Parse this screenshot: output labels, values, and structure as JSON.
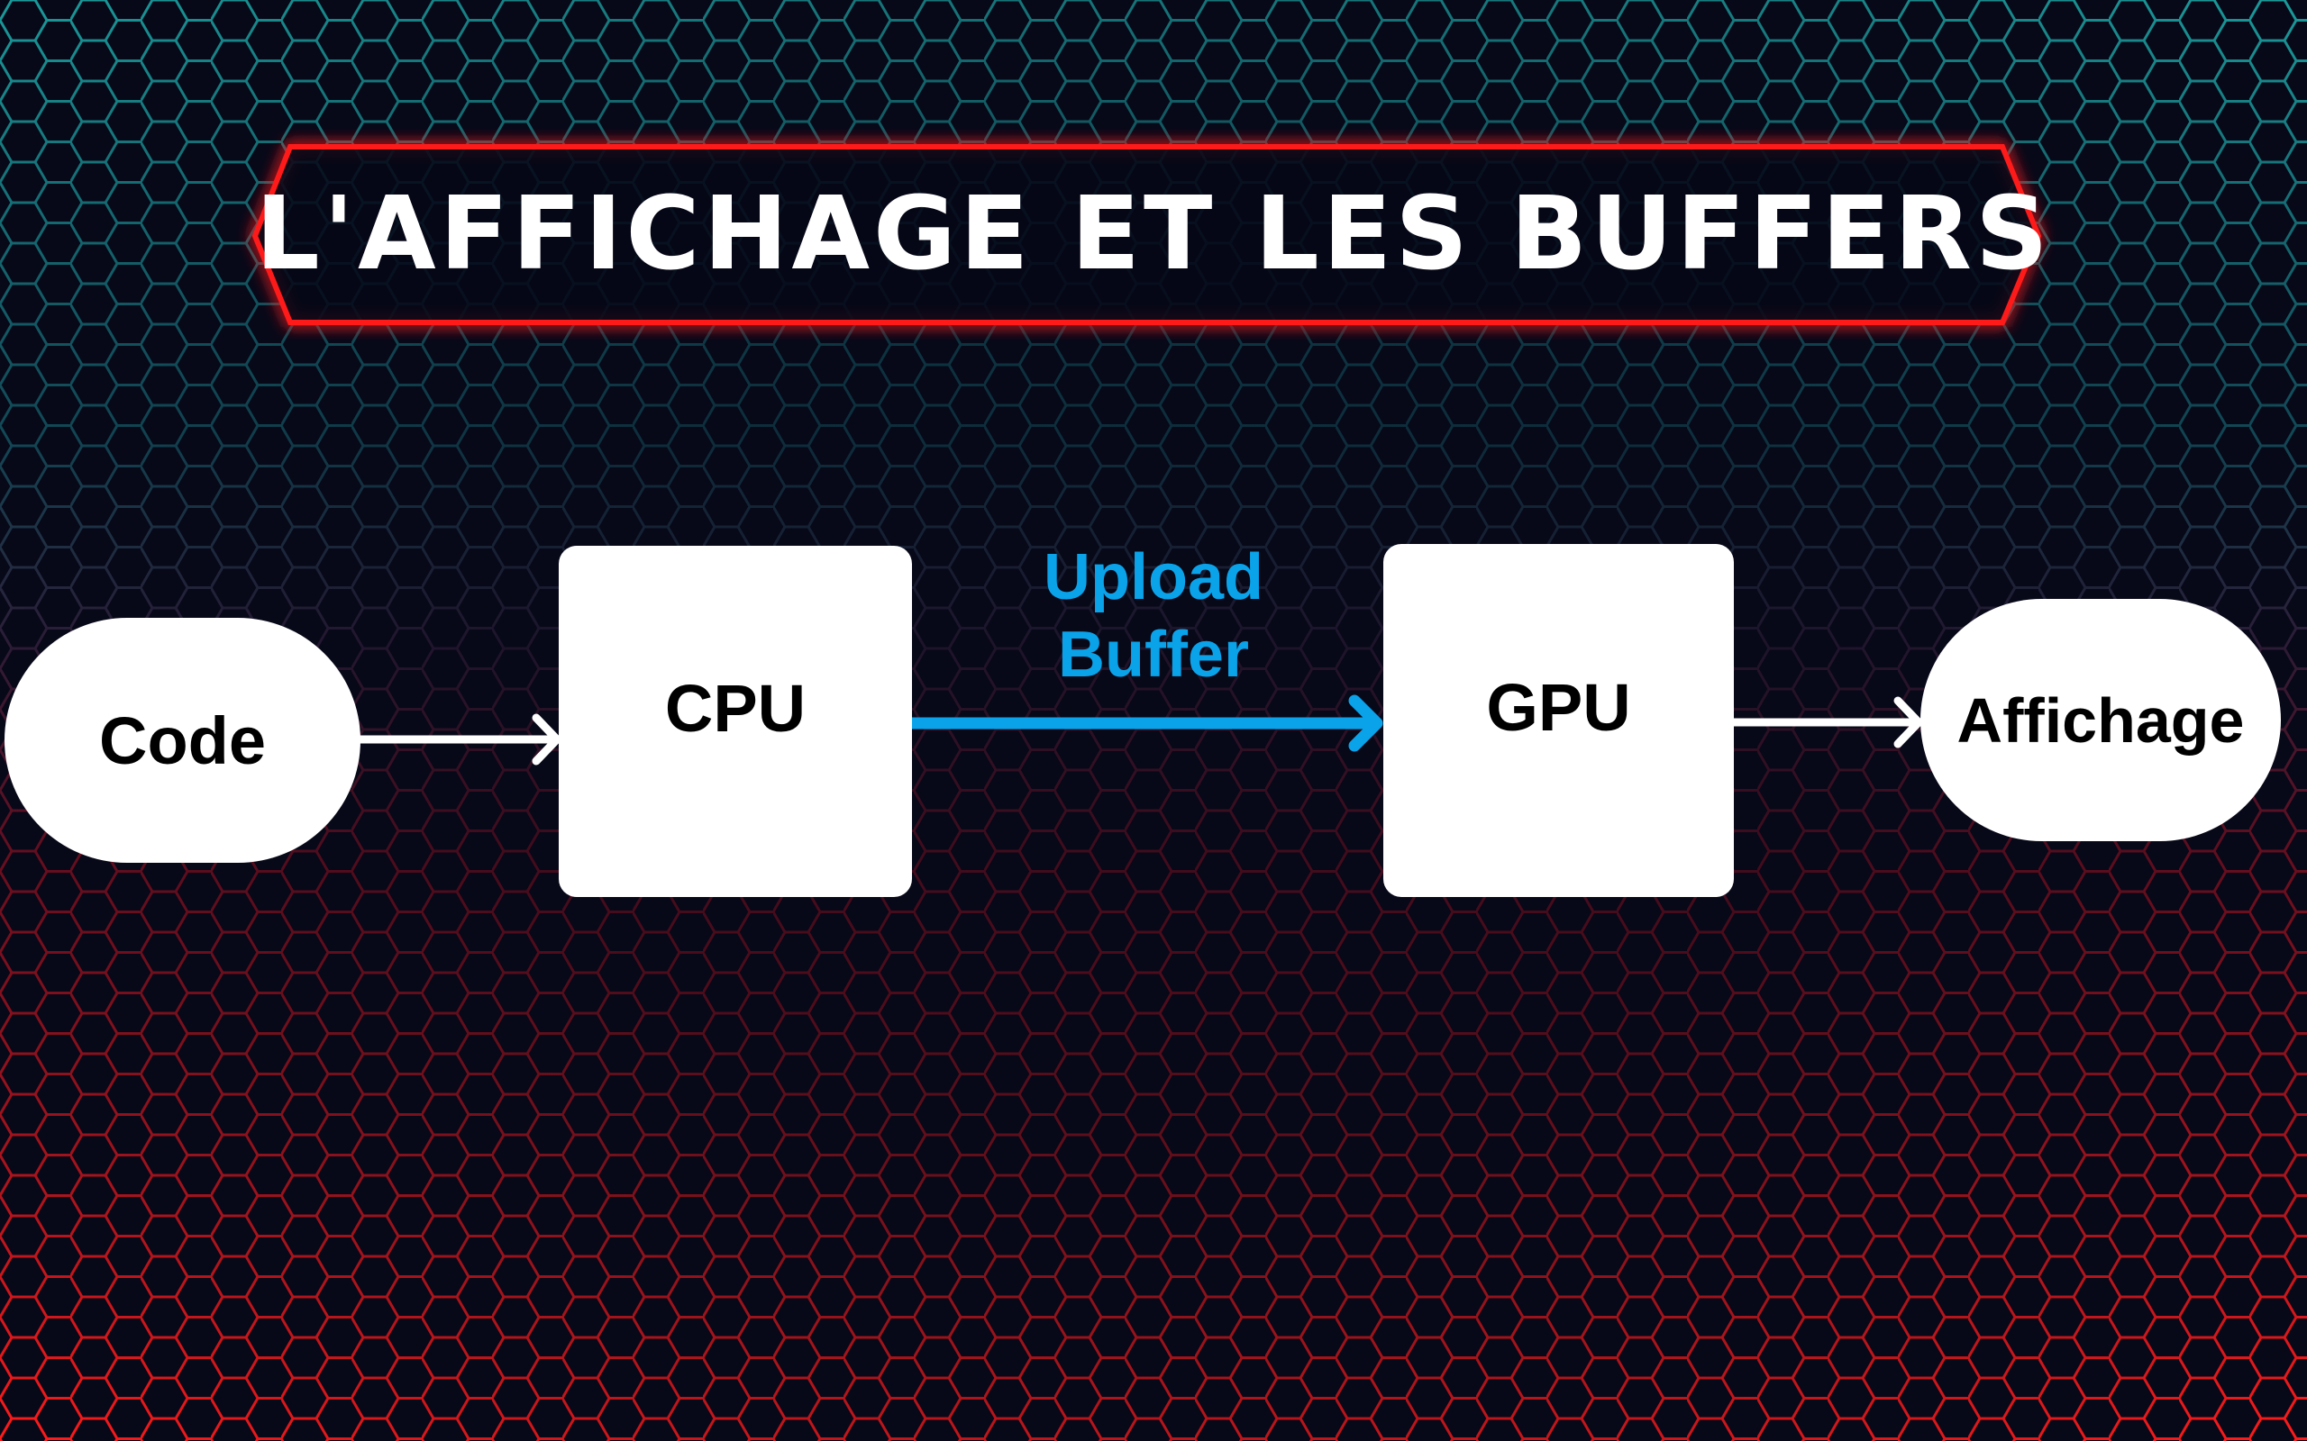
{
  "title": "L'AFFICHAGE ET LES BUFFERS",
  "nodes": {
    "code": "Code",
    "cpu": "CPU",
    "gpu": "GPU",
    "display": "Affichage"
  },
  "edge_label": {
    "line1": "Upload",
    "line2": "Buffer"
  },
  "colors": {
    "banner_border": "#ff1a1a",
    "upload_arrow": "#0aa3ea",
    "hex_top": "#1a8a8a",
    "hex_bottom": "#e01818",
    "background": "#070818"
  }
}
